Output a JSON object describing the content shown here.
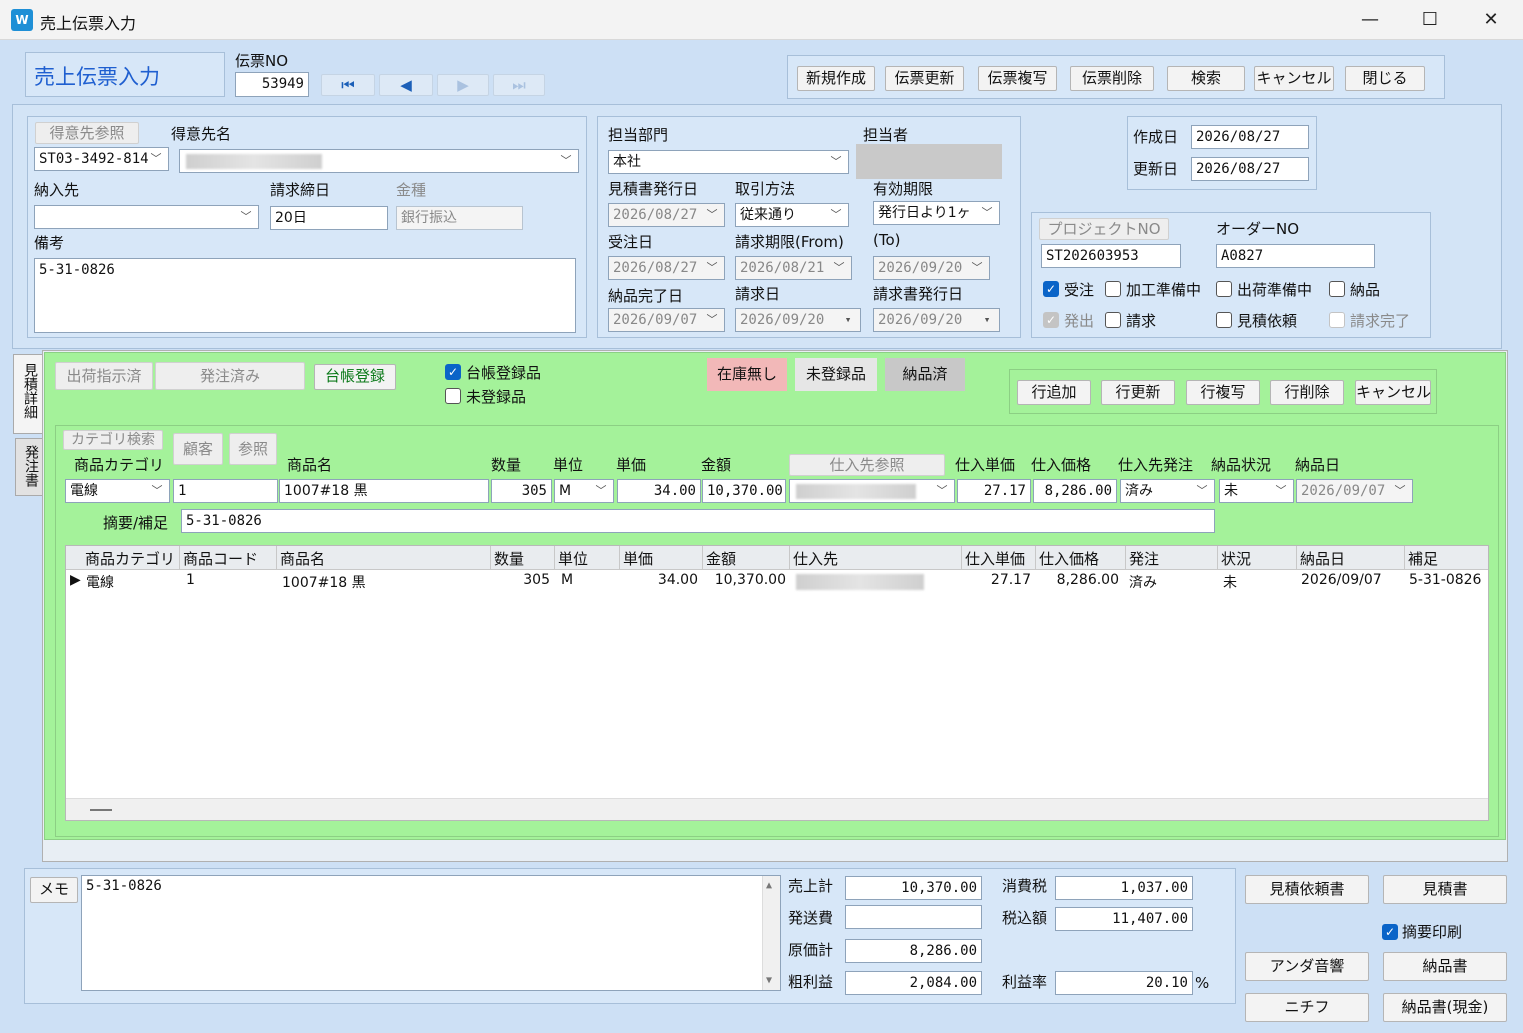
{
  "window": {
    "title": "売上伝票入力",
    "minimize": "—",
    "maximize": "☐",
    "close": "✕"
  },
  "header": {
    "form_title": "売上伝票入力",
    "denpyo_no_label": "伝票NO",
    "denpyo_no": "53949",
    "nav": [
      "⏮",
      "◀",
      "▶",
      "⏭"
    ],
    "buttons": [
      "新規作成",
      "伝票更新",
      "伝票複写",
      "伝票削除",
      "検索",
      "キャンセル",
      "閉じる"
    ]
  },
  "customer": {
    "ref_button": "得意先参照",
    "name_label": "得意先名",
    "code": "ST03-3492-814",
    "delivery_label": "納入先",
    "delivery_value": "",
    "closing_label": "請求締日",
    "closing_value": "20日",
    "kinshu_label": "金種",
    "kinshu_value": "銀行振込",
    "note_label": "備考",
    "note_value": "5-31-0826"
  },
  "staff": {
    "dept_label": "担当部門",
    "dept_value": "本社",
    "person_label": "担当者",
    "quote_date_label": "見積書発行日",
    "quote_date": "2026/08/27",
    "method_label": "取引方法",
    "method_value": "従来通り",
    "valid_label": "有効期限",
    "valid_value": "発行日より1ヶ",
    "order_date_label": "受注日",
    "order_date": "2026/08/27",
    "bill_from_label": "請求期限(From)",
    "bill_from": "2026/08/21",
    "bill_to_label": "(To)",
    "bill_to": "2026/09/20",
    "delivered_label": "納品完了日",
    "delivered_date": "2026/09/07",
    "bill_date_label": "請求日",
    "bill_date": "2026/09/20",
    "invoice_label": "請求書発行日",
    "invoice_date": "2026/09/20"
  },
  "dates": {
    "created_label": "作成日",
    "created": "2026/08/27",
    "updated_label": "更新日",
    "updated": "2026/08/27"
  },
  "project": {
    "ref_button": "プロジェクトNO",
    "project_no": "ST202603953",
    "order_label": "オーダーNO",
    "order_no": "A0827",
    "checks": [
      {
        "label": "受注",
        "state": "on"
      },
      {
        "label": "加工準備中",
        "state": "off"
      },
      {
        "label": "出荷準備中",
        "state": "off"
      },
      {
        "label": "納品",
        "state": "off"
      },
      {
        "label": "発出",
        "state": "dison"
      },
      {
        "label": "請求",
        "state": "off"
      },
      {
        "label": "見積依頼",
        "state": "off"
      },
      {
        "label": "請求完了",
        "state": "disoff"
      }
    ]
  },
  "tabs": [
    "見積詳細",
    "発注書"
  ],
  "detail": {
    "status_btns": [
      "出荷指示済",
      "発注済み"
    ],
    "ledger_button": "台帳登録",
    "ledger_check": "台帳登録品",
    "unreg_check": "未登録品",
    "legend": [
      {
        "label": "在庫無し",
        "color": "#f2b8b8"
      },
      {
        "label": "未登録品",
        "color": "#e6e6e6"
      },
      {
        "label": "納品済",
        "color": "#c8c8c8"
      }
    ],
    "row_buttons": [
      "行追加",
      "行更新",
      "行複写",
      "行削除",
      "キャンセル"
    ],
    "cat_search": "カテゴリ検索",
    "kokyaku": "顧客",
    "sansho": "参照",
    "entry_labels": {
      "category": "商品カテゴリ",
      "name": "商品名",
      "qty": "数量",
      "unit": "単位",
      "price": "単価",
      "amount": "金額",
      "supplier_ref": "仕入先参照",
      "cost_unit": "仕入単価",
      "cost": "仕入価格",
      "order": "仕入先発注",
      "status": "納品状況",
      "deliv": "納品日"
    },
    "entry": {
      "category": "電線",
      "code": "1",
      "name": "1007#18 黒",
      "qty": "305",
      "unit": "M",
      "price": "34.00",
      "amount": "10,370.00",
      "cost_unit": "27.17",
      "cost": "8,286.00",
      "order": "済み",
      "status": "未",
      "deliv": "2026/09/07"
    },
    "summary_label": "摘要/補足",
    "summary_value": "5-31-0826",
    "grid_headers": [
      "商品カテゴリ",
      "商品コード",
      "商品名",
      "数量",
      "単位",
      "単価",
      "金額",
      "仕入先",
      "仕入単価",
      "仕入価格",
      "発注",
      "状況",
      "納品日",
      "補足"
    ],
    "grid_rows": [
      {
        "marker": "▶",
        "category": "電線",
        "code": "1",
        "name": "1007#18 黒",
        "qty": "305",
        "unit": "M",
        "price": "34.00",
        "amount": "10,370.00",
        "cost_unit": "27.17",
        "cost": "8,286.00",
        "order": "済み",
        "status": "未",
        "deliv": "2026/09/07",
        "note": "5-31-0826"
      }
    ]
  },
  "footer": {
    "memo_label": "メモ",
    "memo_value": "5-31-0826",
    "sales_label": "売上計",
    "sales": "10,370.00",
    "tax_label": "消費税",
    "tax": "1,037.00",
    "ship_label": "発送費",
    "ship": "",
    "total_label": "税込額",
    "total": "11,407.00",
    "cost_label": "原価計",
    "cost": "8,286.00",
    "profit_label": "粗利益",
    "profit": "2,084.00",
    "rate_label": "利益率",
    "rate": "20.10",
    "rate_unit": "%",
    "buttons": [
      "見積依頼書",
      "見積書",
      "アンダ音響",
      "納品書",
      "ニチフ",
      "納品書(現金)"
    ],
    "summary_print": "摘要印刷"
  }
}
